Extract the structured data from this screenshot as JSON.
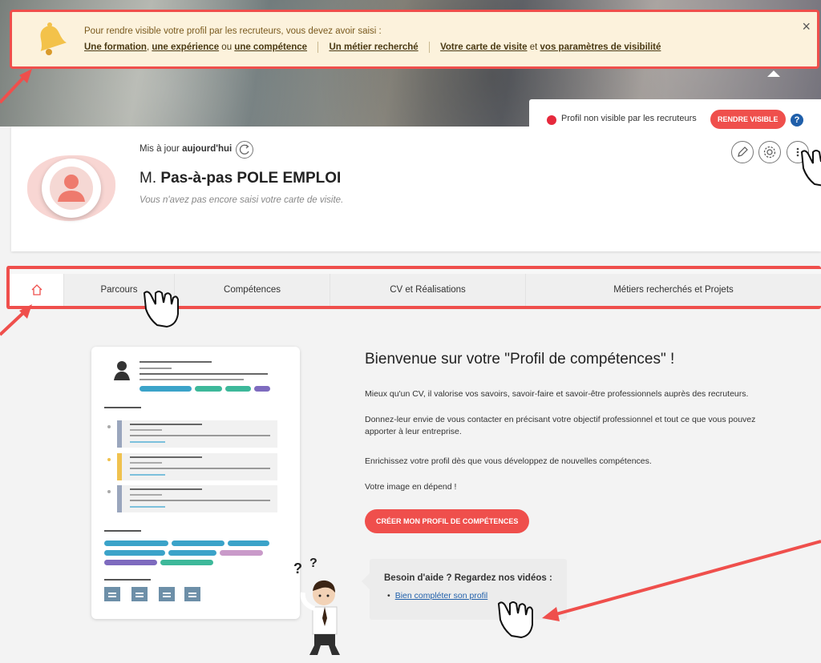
{
  "notification": {
    "line1": "Pour rendre visible votre profil par les recruteurs, vous devez avoir saisi :",
    "link_formation": "Une formation",
    "sep1": ",",
    "link_experience": "une expérience",
    "or_word": "ou",
    "link_competence": "une compétence",
    "link_metier": "Un métier recherché",
    "link_carte": "Votre carte de visite",
    "and_word": "et",
    "link_parametres": "vos paramètres de visibilité",
    "close": "×"
  },
  "visibility": {
    "status": "Profil non visible par les recruteurs",
    "button": "RENDRE VISIBLE",
    "help": "?",
    "status_color": "#e6293c"
  },
  "profile": {
    "updated_prefix": "Mis à jour",
    "updated_value": "aujourd'hui",
    "civility": "M.",
    "name": "Pas-à-pas POLE EMPLOI",
    "tagline": "Vous n'avez pas encore saisi votre carte de visite."
  },
  "actions": {
    "icons": [
      "pencil-icon",
      "gear-icon",
      "more-vertical-icon"
    ]
  },
  "tabs": [
    {
      "label": "",
      "icon": "home-icon"
    },
    {
      "label": "Parcours"
    },
    {
      "label": "Compétences"
    },
    {
      "label": "CV et Réalisations"
    },
    {
      "label": "Métiers recherchés et Projets"
    }
  ],
  "welcome": {
    "title": "Bienvenue sur votre \"Profil de compétences\" !",
    "p1": "Mieux qu'un CV, il valorise vos savoirs, savoir-faire et savoir-être professionnels auprès des recruteurs.",
    "p2": "Donnez-leur envie de vous contacter en précisant votre objectif professionnel et tout ce que vous pouvez apporter à leur entreprise.",
    "p3": "Enrichissez votre profil dès que vous développez de nouvelles compétences.",
    "p4": "Votre image en dépend !",
    "cta": "CRÉER MON PROFIL DE COMPÉTENCES"
  },
  "help": {
    "title": "Besoin d'aide ? Regardez nos vidéos :",
    "link": "Bien compléter son profil",
    "mascot_marks": "?"
  },
  "colors": {
    "accent": "#ef4f4c",
    "notif_bg": "#fcf2dc",
    "link_blue": "#1f5faa"
  }
}
